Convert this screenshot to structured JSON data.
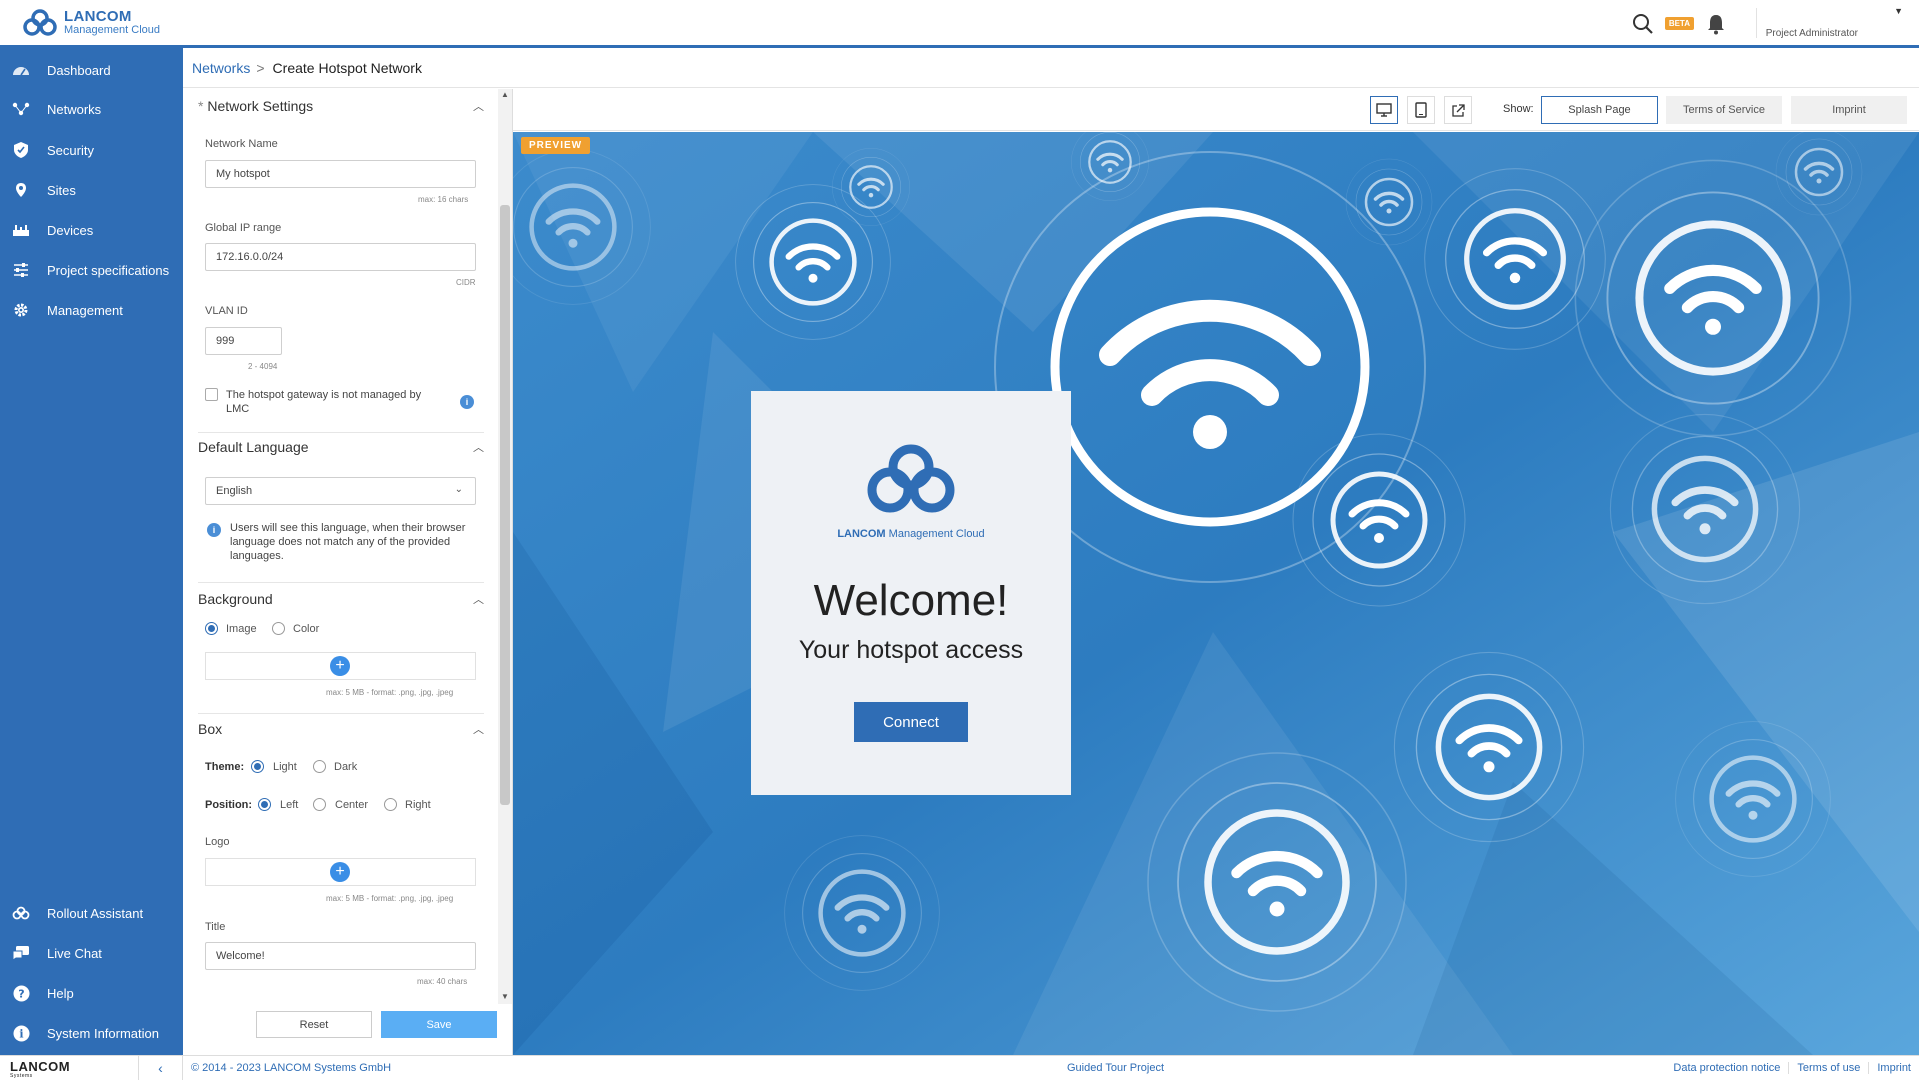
{
  "header": {
    "logo_line1": "LANCOM",
    "logo_line2": "Management Cloud",
    "beta": "BETA",
    "user": "Project Administrator"
  },
  "sidebar": {
    "items": [
      {
        "label": "Dashboard",
        "icon": "dashboard-icon"
      },
      {
        "label": "Networks",
        "icon": "networks-icon"
      },
      {
        "label": "Security",
        "icon": "shield-icon"
      },
      {
        "label": "Sites",
        "icon": "location-pin-icon"
      },
      {
        "label": "Devices",
        "icon": "devices-icon"
      },
      {
        "label": "Project specifications",
        "icon": "sliders-icon"
      },
      {
        "label": "Management",
        "icon": "gear-icon"
      }
    ],
    "bottom_items": [
      {
        "label": "Rollout Assistant",
        "icon": "cloud-icon"
      },
      {
        "label": "Live Chat",
        "icon": "chat-icon"
      },
      {
        "label": "Help",
        "icon": "help-icon"
      },
      {
        "label": "System Information",
        "icon": "info-icon"
      }
    ]
  },
  "breadcrumb": {
    "parent": "Networks",
    "separator": ">",
    "current": "Create Hotspot Network"
  },
  "form": {
    "network_settings": {
      "title": "Network Settings",
      "required_mark": "*",
      "network_name_label": "Network Name",
      "network_name_value": "My hotspot",
      "network_name_hint": "max: 16 chars",
      "ip_range_label": "Global IP range",
      "ip_range_value": "172.16.0.0/24",
      "ip_range_hint": "CIDR",
      "vlan_label": "VLAN ID",
      "vlan_value": "999",
      "vlan_hint": "2 - 4094",
      "gateway_checkbox_label": "The hotspot gateway is not managed by LMC"
    },
    "default_language": {
      "title": "Default Language",
      "selected": "English",
      "info": "Users will see this language, when their browser language does not match any of the provided languages."
    },
    "background": {
      "title": "Background",
      "option_image": "Image",
      "option_color": "Color",
      "selected": "Image",
      "upload_hint": "max: 5 MB - format: .png, .jpg, .jpeg"
    },
    "box": {
      "title": "Box",
      "theme_label": "Theme:",
      "theme_light": "Light",
      "theme_dark": "Dark",
      "theme_selected": "Light",
      "position_label": "Position:",
      "position_left": "Left",
      "position_center": "Center",
      "position_right": "Right",
      "position_selected": "Left",
      "logo_label": "Logo",
      "logo_hint": "max: 5 MB - format: .png, .jpg, .jpeg",
      "title_label": "Title",
      "title_value": "Welcome!",
      "title_hint": "max: 40 chars"
    },
    "reset_label": "Reset",
    "save_label": "Save"
  },
  "preview_toolbar": {
    "show_label": "Show:",
    "options": [
      "Splash Page",
      "Terms of Service",
      "Imprint"
    ],
    "selected": "Splash Page"
  },
  "preview": {
    "tag": "PREVIEW",
    "brand_bold": "LANCOM",
    "brand_rest": " Management Cloud",
    "title": "Welcome!",
    "subtitle": "Your hotspot access",
    "button": "Connect"
  },
  "footer": {
    "brand": "LANCOM",
    "brand_sub": "Systems",
    "copyright": "© 2014 - 2023 LANCOM Systems GmbH",
    "guided_tour": "Guided Tour Project",
    "links": [
      "Data protection notice",
      "Terms of use",
      "Imprint"
    ]
  },
  "colors": {
    "primary": "#2f6db5",
    "accent_orange": "#f0a030",
    "save_button": "#5aaef4"
  }
}
